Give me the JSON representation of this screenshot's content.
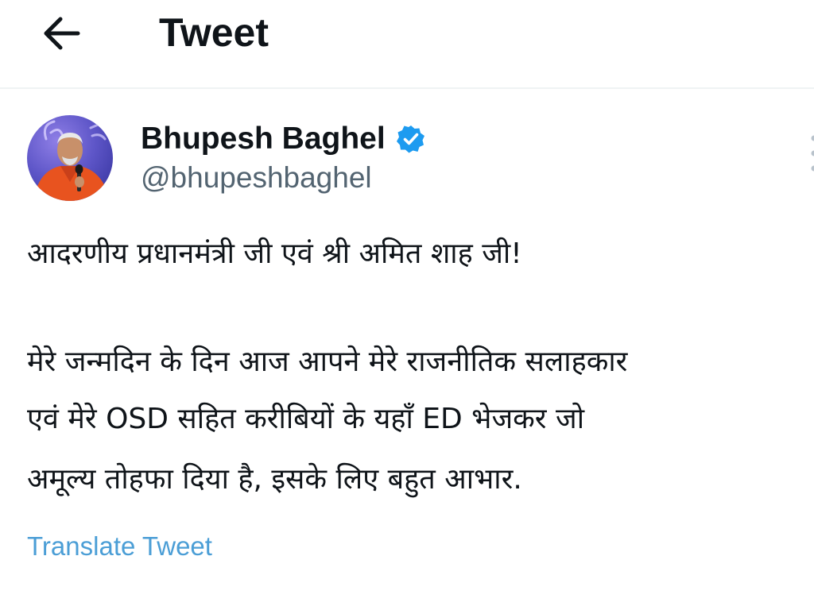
{
  "header": {
    "title": "Tweet",
    "back_icon": "arrow-left-icon"
  },
  "author": {
    "name": "Bhupesh Baghel",
    "handle": "@bhupeshbaghel",
    "verified_icon": "verified-badge-icon",
    "avatar_image": "profile-photo"
  },
  "tweet": {
    "lines": [
      "आदरणीय प्रधानमंत्री जी एवं श्री अमित शाह जी!",
      "मेरे जन्मदिन के दिन आज आपने मेरे राजनीतिक सलाहकार",
      "एवं मेरे OSD सहित करीबियों के यहाँ ED भेजकर जो",
      "अमूल्य तोहफा दिया है, इसके लिए बहुत आभार."
    ],
    "translate_label": "Translate Tweet"
  },
  "colors": {
    "text_primary": "#0f1419",
    "text_secondary": "#536471",
    "link_blue": "#4b9ed6",
    "verified_blue": "#1d9bf0",
    "divider": "#eff3f4"
  }
}
